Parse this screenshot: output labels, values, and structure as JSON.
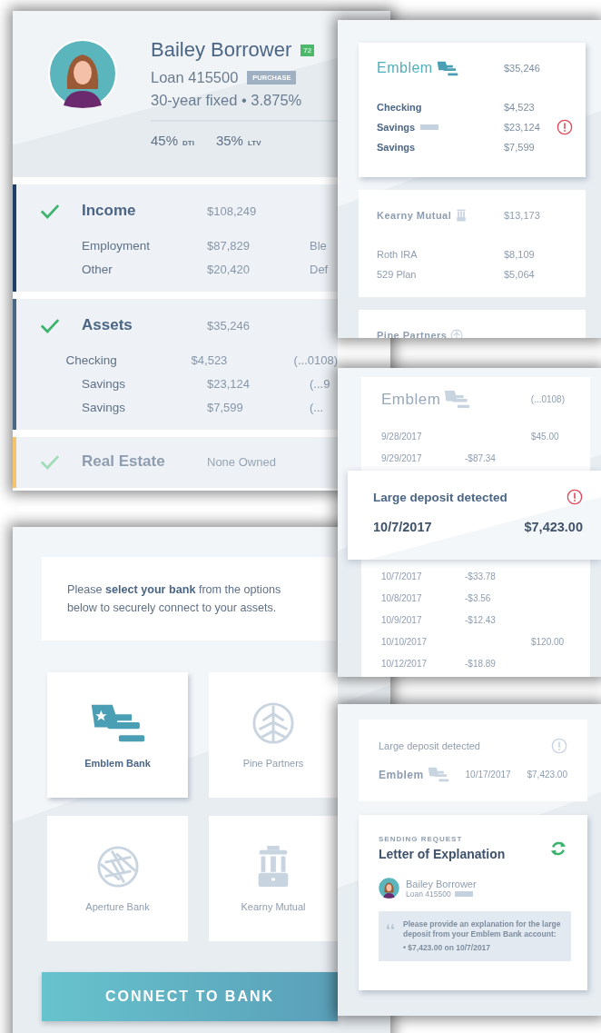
{
  "borrower_panel": {
    "name": "Bailey Borrower",
    "score": "72",
    "loan": "Loan 415500",
    "loan_tag": "PURCHASE",
    "terms": "30-year fixed • 3.875%",
    "ratios": [
      {
        "value": "45%",
        "label": "DTI"
      },
      {
        "value": "35%",
        "label": "LTV"
      }
    ],
    "sections": [
      {
        "title": "Income",
        "amount": "$108,249",
        "checked": true,
        "muted": false,
        "color": "#1f3f66",
        "rows": [
          {
            "label": "Employment",
            "amount": "$87,829",
            "note": "Ble"
          },
          {
            "label": "Other",
            "amount": "$20,420",
            "note": "Def"
          }
        ]
      },
      {
        "title": "Assets",
        "amount": "$35,246",
        "checked": true,
        "muted": false,
        "color": "#4b6584",
        "rows": [
          {
            "label": "Checking",
            "amount": "$4,523",
            "note": "(...0108)"
          },
          {
            "label": "Savings",
            "amount": "$23,124",
            "note": "(...9"
          },
          {
            "label": "Savings",
            "amount": "$7,599",
            "note": "(..."
          }
        ]
      },
      {
        "title": "Real Estate",
        "amount": "None Owned",
        "checked": true,
        "muted": true,
        "color": "#f5c36b"
      }
    ]
  },
  "accounts_panel": {
    "banks": [
      {
        "name": "Emblem",
        "kind": "emblem",
        "total": "$35,246",
        "muted": false,
        "accounts": [
          {
            "name": "Checking",
            "amount": "$4,523",
            "tagged": false,
            "flagged": false
          },
          {
            "name": "Savings",
            "amount": "$23,124",
            "tagged": true,
            "flagged": true
          },
          {
            "name": "Savings",
            "amount": "$7,599",
            "tagged": false,
            "flagged": false
          }
        ]
      },
      {
        "name": "Kearny Mutual",
        "kind": "kearny",
        "total": "$13,173",
        "muted": true,
        "accounts": [
          {
            "name": "Roth IRA",
            "amount": "$8,109",
            "tagged": false,
            "flagged": false
          },
          {
            "name": "529 Plan",
            "amount": "$5,064",
            "tagged": false,
            "flagged": false
          }
        ]
      },
      {
        "name": "Pine Partners",
        "kind": "pine",
        "muted": true
      }
    ]
  },
  "transactions_panel": {
    "bank": "Emblem",
    "account": "(...0108)",
    "items": [
      {
        "kind": "credit",
        "date": "9/28/2017",
        "amount": "$45.00"
      },
      {
        "kind": "debit",
        "date": "9/29/2017",
        "amount": "-$87.34"
      },
      {
        "kind": "alert",
        "title": "Large deposit detected",
        "date": "10/7/2017",
        "amount": "$7,423.00"
      },
      {
        "kind": "debit",
        "date": "10/7/2017",
        "amount": "-$33.78"
      },
      {
        "kind": "debit",
        "date": "10/8/2017",
        "amount": "-$3.56"
      },
      {
        "kind": "debit",
        "date": "10/9/2017",
        "amount": "-$12.43"
      },
      {
        "kind": "credit",
        "date": "10/10/2017",
        "amount": "$120.00"
      },
      {
        "kind": "debit",
        "date": "10/12/2017",
        "amount": "-$18.89"
      }
    ]
  },
  "request_panel": {
    "alert": {
      "title": "Large deposit detected",
      "bank": "Emblem",
      "date": "10/17/2017",
      "amount": "$7,423.00"
    },
    "letter": {
      "status": "SENDING REQUEST",
      "title": "Letter of Explanation",
      "borrower": "Bailey Borrower",
      "loan": "Loan 415500",
      "message": "Please provide an explanation for the large deposit from your Emblem Bank account:",
      "bullet": "• $7,423.00 on 10/7/2017"
    }
  },
  "bank_picker": {
    "prompt": "Please **select your bank** from the options below to securely connect to your assets.",
    "banks": [
      {
        "name": "Emblem Bank",
        "kind": "emblem",
        "selected": true
      },
      {
        "name": "Pine Partners",
        "kind": "pine",
        "selected": false
      },
      {
        "name": "Aperture Bank",
        "kind": "aperture",
        "selected": false
      },
      {
        "name": "Kearny Mutual",
        "kind": "kearny",
        "selected": false
      }
    ],
    "button": "CONNECT TO BANK"
  }
}
